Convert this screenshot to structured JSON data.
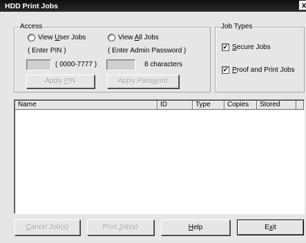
{
  "window": {
    "title": "HDD Print Jobs",
    "close_glyph": "x"
  },
  "access": {
    "legend": "Access",
    "user_jobs": {
      "prefix": "View ",
      "accel": "U",
      "suffix": "ser Jobs"
    },
    "all_jobs": {
      "prefix": "View ",
      "accel": "A",
      "suffix": "ll Jobs"
    },
    "enter_pin": "( Enter PIN )",
    "enter_admin": "( Enter Admin Password )",
    "pin_range": "( 0000-7777 )",
    "password_hint": "8 characters",
    "apply_pin": {
      "prefix": "Apply ",
      "accel": "P",
      "suffix": "IN"
    },
    "apply_password": {
      "prefix": "Apply Pass",
      "accel": "w",
      "suffix": "ord"
    }
  },
  "job_types": {
    "legend": "Job Types",
    "secure": {
      "prefix": "",
      "accel": "S",
      "suffix": "ecure Jobs",
      "checked": true
    },
    "proof": {
      "prefix": "",
      "accel": "P",
      "suffix": "roof and Print Jobs",
      "checked": true
    }
  },
  "table": {
    "columns": [
      "Name",
      "ID",
      "Type",
      "Copies",
      "Stored"
    ],
    "rows": []
  },
  "buttons": {
    "cancel": {
      "prefix": "",
      "accel": "C",
      "suffix": "ancel Job(s)"
    },
    "print": {
      "prefix": "Print ",
      "accel": "J",
      "suffix": "ob(s)"
    },
    "help": {
      "prefix": "",
      "accel": "H",
      "suffix": "elp"
    },
    "exit": {
      "prefix": "E",
      "accel": "x",
      "suffix": "it"
    }
  },
  "check_glyph": "✔"
}
